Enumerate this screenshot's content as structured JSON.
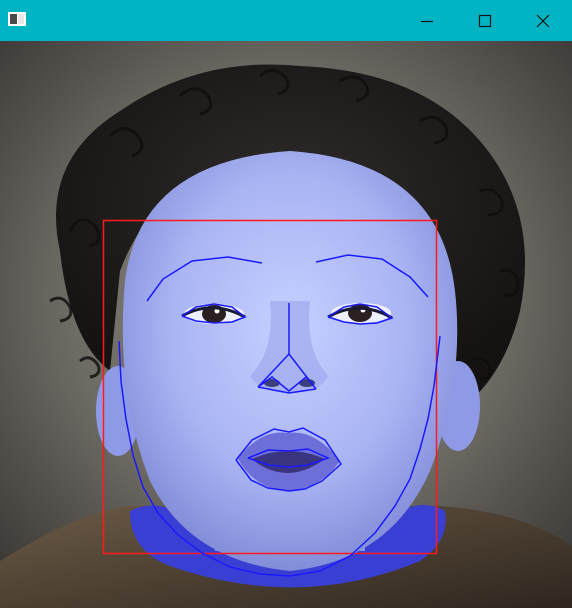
{
  "window": {
    "title": "",
    "accent_color": "#01b4c3",
    "controls": [
      "minimize-icon",
      "maximize-icon",
      "close-icon"
    ]
  },
  "image": {
    "subject": "face-photo-with-landmark-overlay",
    "bounding_box_color": "#ff1a1a",
    "landmark_color": "#1a1aff"
  }
}
